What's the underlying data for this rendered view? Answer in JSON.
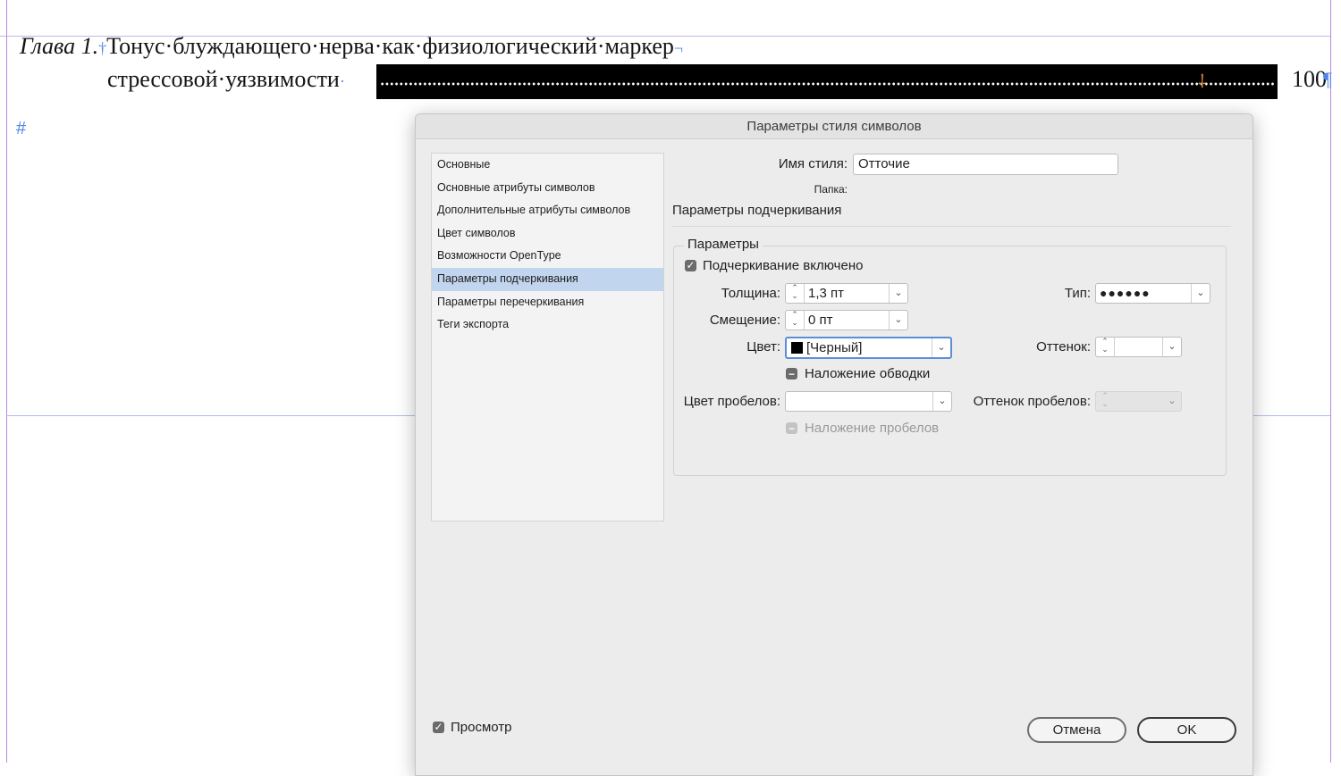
{
  "document": {
    "chapter_label": "Глава 1.",
    "title_line1": "Тонус·блуждающего·нерва·как·физиологический·маркер",
    "title_line2": "стрессовой·уязвимости",
    "page_number": "100",
    "hash_mark": "#",
    "pilcrow": "¶"
  },
  "dialog": {
    "title": "Параметры стиля символов",
    "categories": [
      "Основные",
      "Основные атрибуты символов",
      "Дополнительные атрибуты символов",
      "Цвет символов",
      "Возможности OpenType",
      "Параметры подчеркивания",
      "Параметры перечеркивания",
      "Теги экспорта"
    ],
    "selected_category": "Параметры подчеркивания",
    "style_name_label": "Имя стиля:",
    "style_name_value": "Отточие",
    "folder_label": "Папка:",
    "section_title": "Параметры подчеркивания",
    "group_label": "Параметры",
    "underline_on_label": "Подчеркивание включено",
    "underline_on": true,
    "weight_label": "Толщина:",
    "weight_value": "1,3 пт",
    "type_label": "Тип:",
    "type_value": "●●●●●●",
    "offset_label": "Смещение:",
    "offset_value": "0 пт",
    "color_label": "Цвет:",
    "color_value": "[Черный]",
    "tint_label": "Оттенок:",
    "tint_value": "",
    "overprint_stroke_label": "Наложение обводки",
    "gap_color_label": "Цвет пробелов:",
    "gap_color_value": "",
    "gap_tint_label": "Оттенок пробелов:",
    "overprint_gap_label": "Наложение пробелов",
    "preview_label": "Просмотр",
    "preview_on": true,
    "cancel_label": "Отмена",
    "ok_label": "OK"
  },
  "colors": {
    "selection": "#c2d5ee",
    "guide": "#b48be0",
    "focus": "#5b8ed6",
    "invisibles": "#4f86e8"
  }
}
